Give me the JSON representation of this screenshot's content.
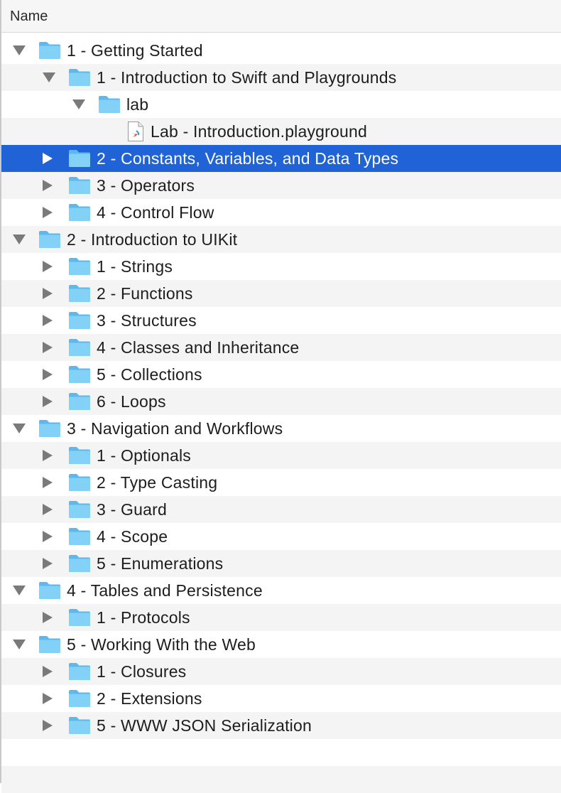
{
  "header": {
    "name_label": "Name"
  },
  "items": [
    {
      "label": "1 - Getting Started",
      "level": 0,
      "state": "expanded",
      "kind": "folder"
    },
    {
      "label": "1 - Introduction to Swift and Playgrounds",
      "level": 1,
      "state": "expanded",
      "kind": "folder"
    },
    {
      "label": "lab",
      "level": 2,
      "state": "expanded",
      "kind": "folder"
    },
    {
      "label": "Lab - Introduction.playground",
      "level": 3,
      "state": "none",
      "kind": "playground-file"
    },
    {
      "label": "2 - Constants, Variables, and Data Types",
      "level": 1,
      "state": "collapsed",
      "kind": "folder",
      "selected": true
    },
    {
      "label": "3 - Operators",
      "level": 1,
      "state": "collapsed",
      "kind": "folder"
    },
    {
      "label": "4 - Control Flow",
      "level": 1,
      "state": "collapsed",
      "kind": "folder"
    },
    {
      "label": "2 - Introduction to UIKit",
      "level": 0,
      "state": "expanded",
      "kind": "folder"
    },
    {
      "label": "1 - Strings",
      "level": 1,
      "state": "collapsed",
      "kind": "folder"
    },
    {
      "label": "2 - Functions",
      "level": 1,
      "state": "collapsed",
      "kind": "folder"
    },
    {
      "label": "3 - Structures",
      "level": 1,
      "state": "collapsed",
      "kind": "folder"
    },
    {
      "label": "4 - Classes and Inheritance",
      "level": 1,
      "state": "collapsed",
      "kind": "folder"
    },
    {
      "label": "5 - Collections",
      "level": 1,
      "state": "collapsed",
      "kind": "folder"
    },
    {
      "label": "6 - Loops",
      "level": 1,
      "state": "collapsed",
      "kind": "folder"
    },
    {
      "label": "3 - Navigation and Workflows",
      "level": 0,
      "state": "expanded",
      "kind": "folder"
    },
    {
      "label": "1 - Optionals",
      "level": 1,
      "state": "collapsed",
      "kind": "folder"
    },
    {
      "label": "2 - Type Casting",
      "level": 1,
      "state": "collapsed",
      "kind": "folder"
    },
    {
      "label": "3 - Guard",
      "level": 1,
      "state": "collapsed",
      "kind": "folder"
    },
    {
      "label": "4 - Scope",
      "level": 1,
      "state": "collapsed",
      "kind": "folder"
    },
    {
      "label": "5 - Enumerations",
      "level": 1,
      "state": "collapsed",
      "kind": "folder"
    },
    {
      "label": "4 - Tables and Persistence",
      "level": 0,
      "state": "expanded",
      "kind": "folder"
    },
    {
      "label": "1 - Protocols",
      "level": 1,
      "state": "collapsed",
      "kind": "folder"
    },
    {
      "label": "5 - Working With the Web",
      "level": 0,
      "state": "expanded",
      "kind": "folder"
    },
    {
      "label": "1 - Closures",
      "level": 1,
      "state": "collapsed",
      "kind": "folder"
    },
    {
      "label": "2 - Extensions",
      "level": 1,
      "state": "collapsed",
      "kind": "folder"
    },
    {
      "label": "5 - WWW JSON Serialization",
      "level": 1,
      "state": "collapsed",
      "kind": "folder"
    },
    {
      "label": "",
      "level": 0,
      "state": "none",
      "kind": "empty"
    },
    {
      "label": "",
      "level": 0,
      "state": "none",
      "kind": "empty"
    }
  ],
  "colors": {
    "selection": "#1f63d6",
    "folder": "#7fcdf6",
    "stripe": "#f4f4f4"
  },
  "icons": {
    "folder": "folder-icon",
    "file": "swift-playground-file-icon",
    "expanded": "disclosure-triangle-down-icon",
    "collapsed": "disclosure-triangle-right-icon"
  }
}
